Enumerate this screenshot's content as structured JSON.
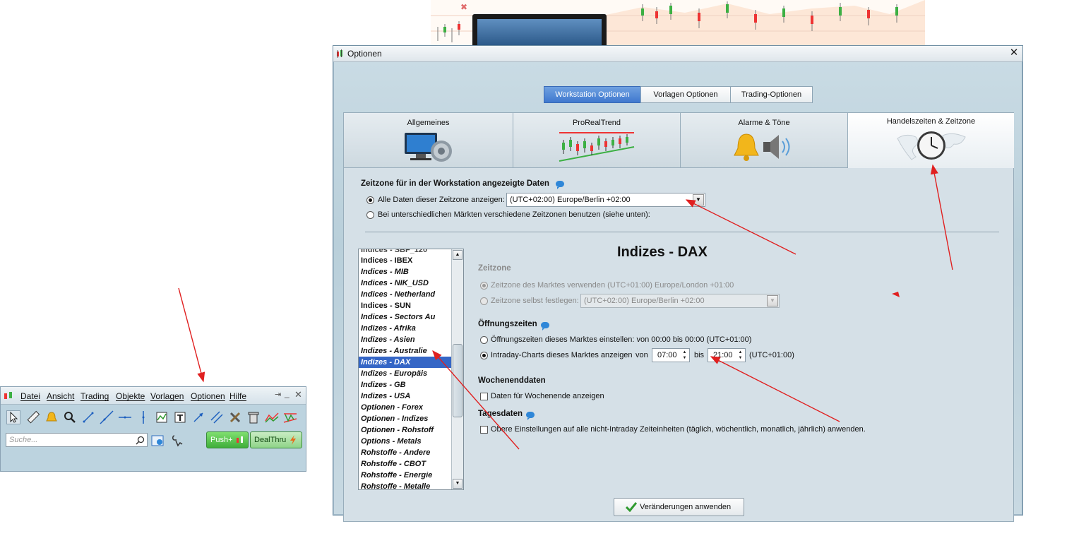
{
  "window": {
    "title": "Optionen",
    "top_tabs": [
      "Workstation Optionen",
      "Vorlagen Optionen",
      "Trading-Optionen"
    ],
    "active_top_tab": "Workstation Optionen",
    "category_tabs": [
      "Allgemeines",
      "ProRealTrend",
      "Alarme & Töne",
      "Handelszeiten & Zeitzone"
    ],
    "selected_category": "Handelszeiten & Zeitzone"
  },
  "timezone": {
    "heading": "Zeitzone für in der Workstation angezeigte Daten",
    "option_all": "Alle Daten dieser Zeitzone anzeigen:",
    "option_all_value": "(UTC+02:00) Europe/Berlin +02:00",
    "option_markets": "Bei unterschiedlichen Märkten verschiedene Zeitzonen benutzen (siehe unten):"
  },
  "market_list": {
    "items": [
      {
        "label": "Indices - IBEX",
        "style": "plain"
      },
      {
        "label": "Indices - MIB",
        "style": "italic"
      },
      {
        "label": "Indices - NIK_USD",
        "style": "italic"
      },
      {
        "label": "Indices - Netherland",
        "style": "italic"
      },
      {
        "label": "Indices - SUN",
        "style": "plain"
      },
      {
        "label": "Indices - Sectors Au",
        "style": "italic"
      },
      {
        "label": "Indizes - Afrika",
        "style": "italic"
      },
      {
        "label": "Indizes - Asien",
        "style": "italic"
      },
      {
        "label": "Indizes - Australie",
        "style": "italic"
      },
      {
        "label": "Indizes - DAX",
        "style": "italic"
      },
      {
        "label": "Indizes - Europäis",
        "style": "italic"
      },
      {
        "label": "Indizes - GB",
        "style": "italic"
      },
      {
        "label": "Indizes - USA",
        "style": "italic"
      },
      {
        "label": "Optionen - Forex",
        "style": "italic"
      },
      {
        "label": "Optionen - Indizes",
        "style": "italic"
      },
      {
        "label": "Optionen - Rohstoff",
        "style": "italic"
      },
      {
        "label": "Options - Metals",
        "style": "italic"
      },
      {
        "label": "Rohstoffe - Andere",
        "style": "italic"
      },
      {
        "label": "Rohstoffe - CBOT",
        "style": "italic"
      },
      {
        "label": "Rohstoffe - Energie",
        "style": "italic"
      },
      {
        "label": "Rohstoffe - Metalle",
        "style": "italic"
      }
    ],
    "selected": "Indizes - DAX"
  },
  "market": {
    "title": "Indizes - DAX",
    "zeitzone_heading": "Zeitzone",
    "zz_option_market": "Zeitzone des Marktes verwenden (UTC+01:00) Europe/London +01:00",
    "zz_option_custom": "Zeitzone selbst festlegen:",
    "zz_custom_value": "(UTC+02:00) Europe/Berlin +02:00",
    "hours_heading": "Öffnungszeiten",
    "hours_option_market": "Öffnungszeiten dieses Marktes einstellen: von 00:00 bis 00:00  (UTC+01:00)",
    "hours_option_intraday": "Intraday-Charts dieses Marktes anzeigen",
    "von": "von",
    "from": "07:00",
    "bis": "bis",
    "to": "21:00",
    "utc": "(UTC+01:00)",
    "weekend_heading": "Wochenenddaten",
    "weekend_option": "Daten für Wochenende anzeigen",
    "daily_heading": "Tagesdaten",
    "daily_option": "Obere Einstellungen auf alle nicht-Intraday Zeiteinheiten (täglich, wöchentlich, monatlich, jährlich) anwenden."
  },
  "apply_button": "Veränderungen anwenden",
  "toolbar_window": {
    "menu": [
      "Datei",
      "Ansicht",
      "Trading",
      "Objekte",
      "Vorlagen",
      "Optionen",
      "Hilfe"
    ],
    "search_placeholder": "Suche...",
    "push_button": "Push+",
    "dealthru_button": "DealThru"
  },
  "colors": {
    "accent": "#3f78cf",
    "selection": "#3566c6",
    "annotation_arrow": "#e02020",
    "buy_green": "#3fae3a"
  }
}
